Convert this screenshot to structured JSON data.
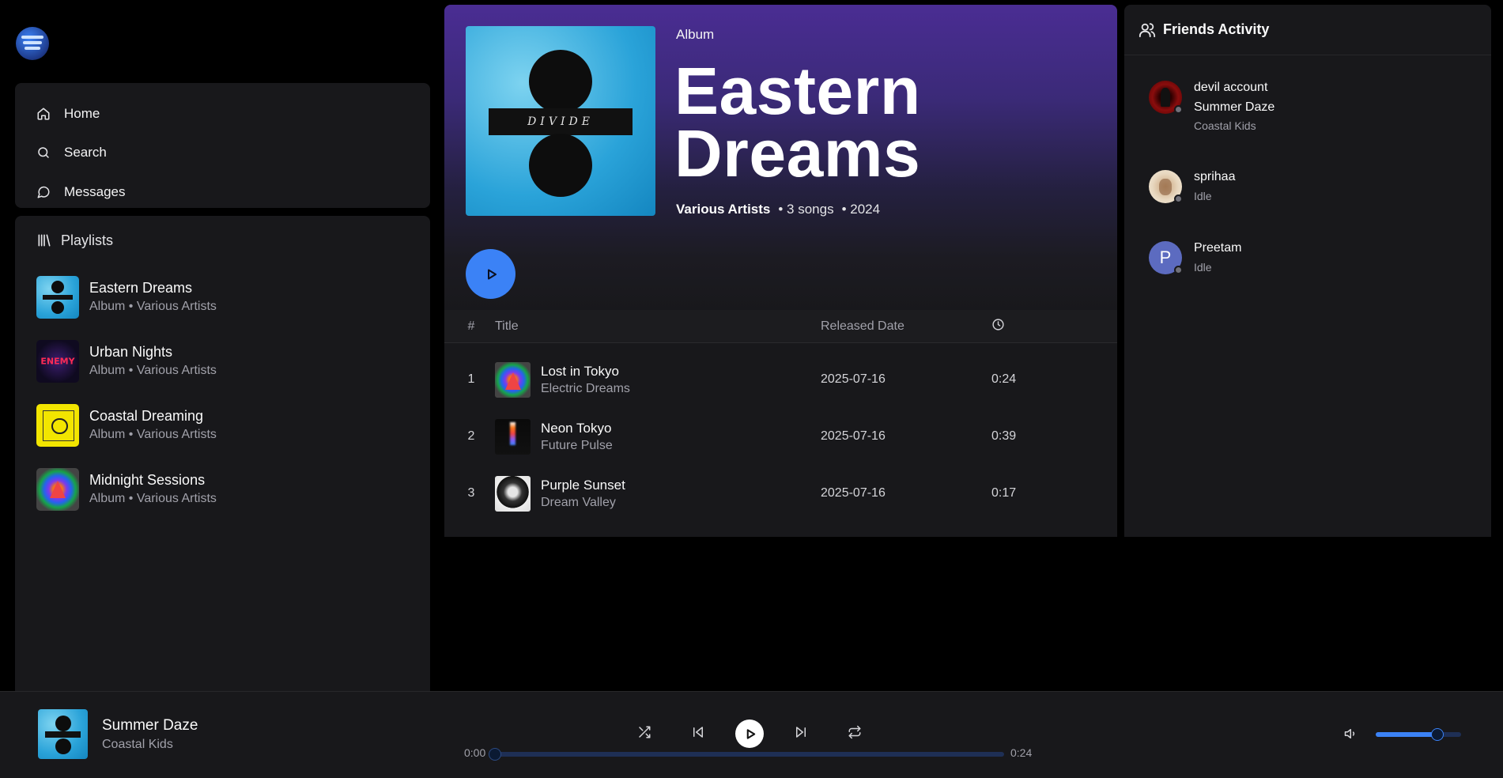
{
  "nav": {
    "items": [
      {
        "label": "Home",
        "icon": "home-icon"
      },
      {
        "label": "Search",
        "icon": "search-icon"
      },
      {
        "label": "Messages",
        "icon": "message-icon"
      }
    ]
  },
  "library": {
    "title": "Playlists",
    "items": [
      {
        "title": "Eastern Dreams",
        "subtitle": "Album • Various Artists"
      },
      {
        "title": "Urban Nights",
        "subtitle": "Album • Various Artists"
      },
      {
        "title": "Coastal Dreaming",
        "subtitle": "Album • Various Artists"
      },
      {
        "title": "Midnight Sessions",
        "subtitle": "Album • Various Artists"
      }
    ]
  },
  "album": {
    "type": "Album",
    "title": "Eastern Dreams",
    "artist": "Various Artists",
    "song_count": "• 3 songs",
    "year": "• 2024",
    "cover_text": "DIVIDE"
  },
  "tracks": {
    "headers": {
      "num": "#",
      "title": "Title",
      "date": "Released Date"
    },
    "rows": [
      {
        "num": "1",
        "name": "Lost in Tokyo",
        "artist": "Electric Dreams",
        "date": "2025-07-16",
        "duration": "0:24"
      },
      {
        "num": "2",
        "name": "Neon Tokyo",
        "artist": "Future Pulse",
        "date": "2025-07-16",
        "duration": "0:39"
      },
      {
        "num": "3",
        "name": "Purple Sunset",
        "artist": "Dream Valley",
        "date": "2025-07-16",
        "duration": "0:17"
      }
    ]
  },
  "friends": {
    "title": "Friends Activity",
    "list": [
      {
        "name": "devil account",
        "song": "Summer Daze",
        "status": "Coastal Kids"
      },
      {
        "name": "sprihaa",
        "status": "Idle"
      },
      {
        "name": "Preetam",
        "initial": "P",
        "status": "Idle"
      }
    ]
  },
  "player": {
    "title": "Summer Daze",
    "artist": "Coastal Kids",
    "time_current": "0:00",
    "time_total": "0:24",
    "progress": 0,
    "volume": 0.72
  },
  "colors": {
    "accent": "#3b82f6",
    "panel": "#18181b",
    "hero": "#4a2d93"
  }
}
